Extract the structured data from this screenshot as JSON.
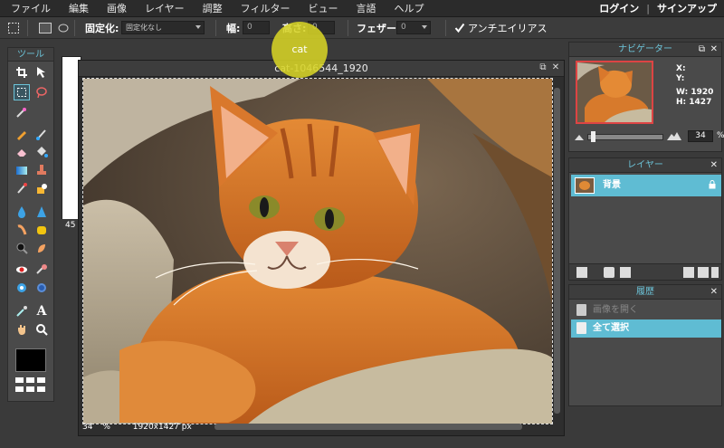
{
  "menu": [
    "ファイル",
    "編集",
    "画像",
    "レイヤー",
    "調整",
    "フィルター",
    "ビュー",
    "言語",
    "ヘルプ"
  ],
  "auth": {
    "login": "ログイン",
    "separator": "|",
    "signup": "サインアップ"
  },
  "options": {
    "fixed_label": "固定化:",
    "fixed_value": "固定化なし",
    "width_label": "幅:",
    "width_value": "0",
    "height_label": "高さ:",
    "height_value": "0",
    "feather_label": "フェザー:",
    "feather_value": "0",
    "antialias_label": "アンチエイリアス",
    "antialias_checked": true
  },
  "tools": {
    "title": "ツール",
    "foreground_color": "#000000"
  },
  "background_doc": {
    "zoom": "45"
  },
  "highlight": {
    "text": "cat",
    "color": "#d6d326"
  },
  "document": {
    "title": "cat-1046544_1920",
    "zoom": "34",
    "zoom_unit": "%",
    "dimensions": "1920x1427 px"
  },
  "navigator": {
    "title": "ナビゲーター",
    "x_label": "X:",
    "y_label": "Y:",
    "w_label": "W:",
    "w_value": "1920",
    "h_label": "H:",
    "h_value": "1427",
    "zoom": "34",
    "zoom_unit": "%"
  },
  "layers": {
    "title": "レイヤー",
    "items": [
      {
        "name": "背景",
        "locked": true
      }
    ]
  },
  "history": {
    "title": "履歴",
    "items": [
      {
        "label": "画像を開く",
        "active": false
      },
      {
        "label": "全て選択",
        "active": true
      }
    ]
  },
  "colors": {
    "accent": "#5fbcd3",
    "panel_header_text": "#6cc3d8"
  }
}
